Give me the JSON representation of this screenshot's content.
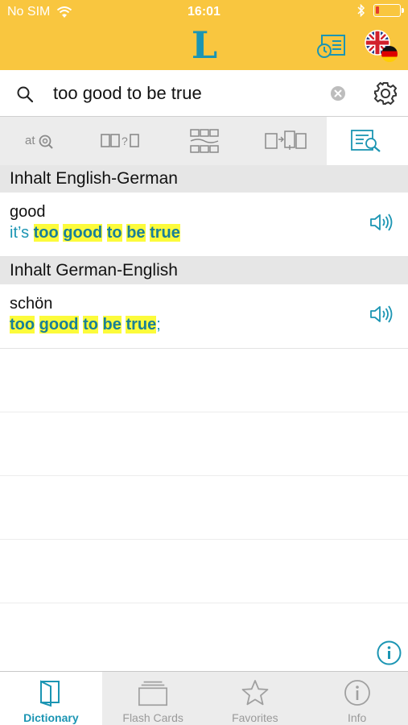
{
  "status_bar": {
    "carrier": "No SIM",
    "time": "16:01",
    "battery_level": 0.15
  },
  "header": {
    "logo": "L"
  },
  "search": {
    "query": "too good to be true"
  },
  "colors": {
    "header_bg": "#f9c63f",
    "accent": "#1b95b3",
    "highlight": "#fcfb3b"
  },
  "mode_tabs": [
    {
      "icon": "at-search-icon",
      "active": false
    },
    {
      "icon": "missing-letters-icon",
      "active": false
    },
    {
      "icon": "word-grid-icon",
      "active": false
    },
    {
      "icon": "translate-pages-icon",
      "active": false
    },
    {
      "icon": "fulltext-search-icon",
      "active": true
    }
  ],
  "sections": [
    {
      "title": "Inhalt English-German",
      "entries": [
        {
          "headword": "good",
          "example_prefix": "it’s ",
          "example_parts": [
            "too",
            "good",
            "to",
            "be",
            "true"
          ],
          "example_suffix": ""
        }
      ]
    },
    {
      "title": "Inhalt German-English",
      "entries": [
        {
          "headword": "schön",
          "example_prefix": "",
          "example_parts": [
            "too",
            "good",
            "to",
            "be",
            "true"
          ],
          "example_suffix": ";"
        }
      ]
    }
  ],
  "tab_bar": [
    {
      "label": "Dictionary",
      "icon": "book-icon",
      "active": true
    },
    {
      "label": "Flash Cards",
      "icon": "cards-icon",
      "active": false
    },
    {
      "label": "Favorites",
      "icon": "star-icon",
      "active": false
    },
    {
      "label": "Info",
      "icon": "info-icon",
      "active": false
    }
  ]
}
